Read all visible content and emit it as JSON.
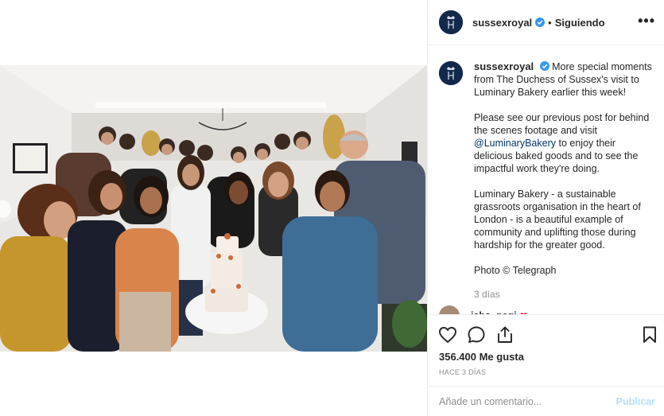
{
  "post": {
    "username": "sussexroyal",
    "follow_separator": "•",
    "follow_status": "Siguiendo",
    "more_label": "•••"
  },
  "caption": {
    "username": "sussexroyal",
    "paragraph_1": "More special moments from The Duchess of Sussex's visit to Luminary Bakery earlier this week!",
    "paragraph_2_before": "Please see our previous post for behind the scenes footage and visit ",
    "paragraph_2_mention": "@LuminaryBakery",
    "paragraph_2_after": " to enjoy their delicious baked goods and to see the impactful work they're doing.",
    "paragraph_3": "Luminary Bakery - a sustainable grassroots organisation in the heart of London - is a beautiful example of community and uplifting those during hardship for the greater good.",
    "paragraph_4": "Photo © Telegraph",
    "time": "3 días"
  },
  "next_comment": {
    "username": "isha_negi",
    "emoji": "❤"
  },
  "actions": {
    "like_icon": "heart-icon",
    "comment_icon": "comment-icon",
    "share_icon": "share-icon",
    "save_icon": "bookmark-icon",
    "likes_text": "356.400 Me gusta",
    "posted_ago": "HACE 3 DÍAS"
  },
  "comment_form": {
    "placeholder": "Añade un comentario...",
    "publish_label": "Publicar"
  },
  "colors": {
    "verified_blue": "#3897f0",
    "avatar_navy": "#13294b",
    "publish_disabled": "#b2dffc",
    "mention": "#003569"
  }
}
